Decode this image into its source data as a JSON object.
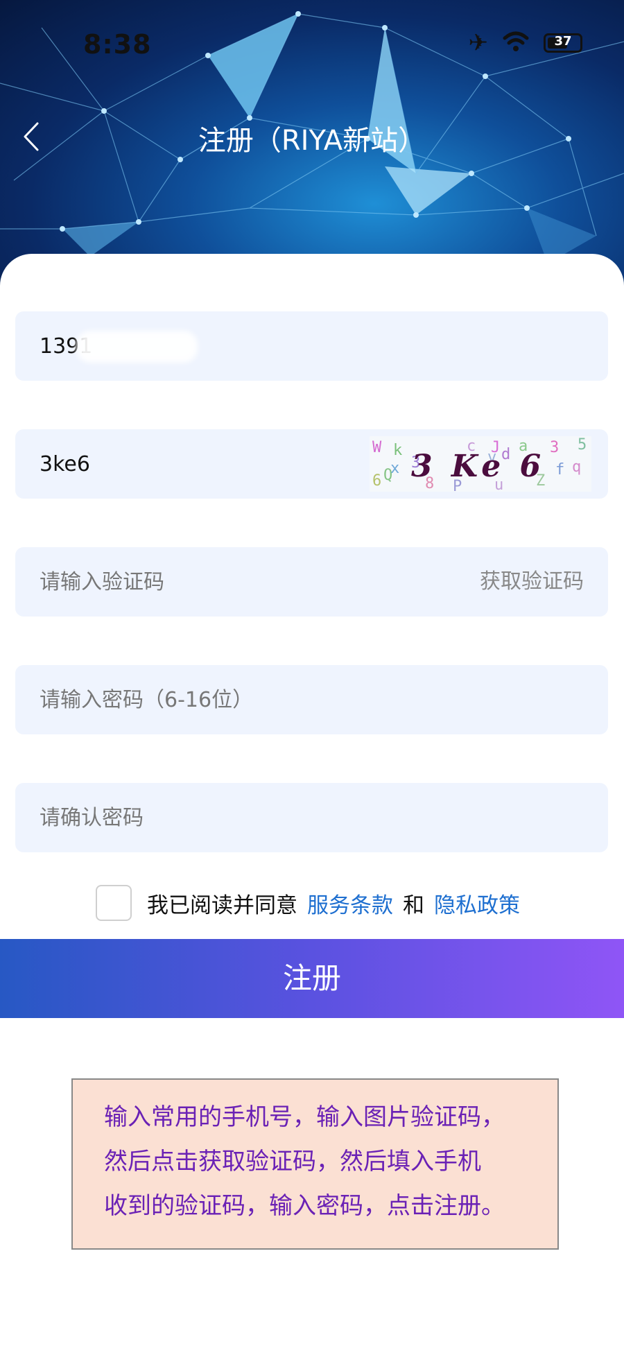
{
  "status_bar": {
    "time": "8:38",
    "battery": "37"
  },
  "nav": {
    "title": "注册（RIYA新站）"
  },
  "form": {
    "phone_value": "1391",
    "captcha_input_value": "3ke6",
    "captcha_image_text": "3 Ke 6",
    "captcha_noise": [
      "W",
      "k",
      "3",
      "c",
      "J",
      "a",
      "3",
      "5",
      "v",
      "d",
      "f",
      "q",
      "Q",
      "Z",
      "6",
      "8",
      "P",
      "x",
      "u"
    ],
    "sms_code_placeholder": "请输入验证码",
    "get_code_label": "获取验证码",
    "password_placeholder": "请输入密码（6-16位）",
    "confirm_password_placeholder": "请确认密码"
  },
  "agreement": {
    "prefix": "我已阅读并同意",
    "terms_label": "服务条款",
    "conjunction": "和",
    "privacy_label": "隐私政策"
  },
  "register_button": "注册",
  "tip": {
    "lines": [
      "输入常用的手机号，输入图片验证码，",
      "然后点击获取验证码，然后填入手机",
      "收到的验证码，输入密码，点击注册。"
    ]
  },
  "colors": {
    "accent_link": "#1e6fd0",
    "button_gradient_start": "#2758c4",
    "button_gradient_end": "#8f55f6",
    "field_background": "#eff4fe",
    "tip_background": "#fbe0d3",
    "tip_text": "#6a21b5"
  }
}
